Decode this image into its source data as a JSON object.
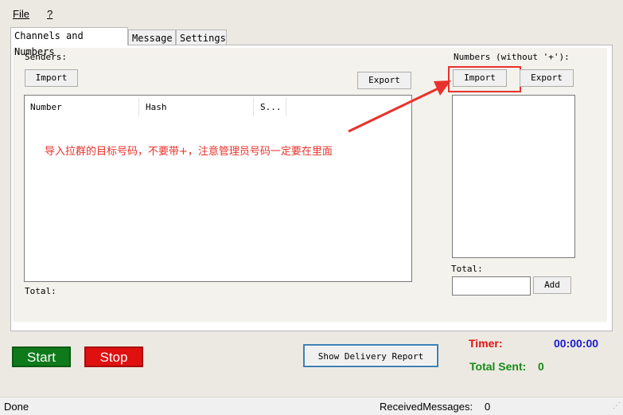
{
  "menu": {
    "file": "File",
    "help": "?"
  },
  "tabs": [
    "Channels and Numbers",
    "Message",
    "Settings"
  ],
  "senders": {
    "label": "Senders:",
    "import": "Import",
    "export": "Export",
    "columns": [
      "Number",
      "Hash",
      "S..."
    ],
    "total_label": "Total:"
  },
  "numbers": {
    "label": "Numbers (without '+'):",
    "import": "Import",
    "export": "Export",
    "total_label": "Total:",
    "add": "Add",
    "input_value": ""
  },
  "annotation": {
    "text": "导入拉群的目标号码，不要带+，注意管理员号码一定要在里面",
    "color": "#e8322b"
  },
  "controls": {
    "start": "Start",
    "stop": "Stop",
    "report": "Show Delivery Report"
  },
  "timer": {
    "label": "Timer:",
    "value": "00:00:00",
    "total_label": "Total Sent:",
    "total_value": "0"
  },
  "status": {
    "left": "Done",
    "received_label": "ReceivedMessages:",
    "received_value": "0"
  },
  "colors": {
    "start_bg": "#0f7a1c",
    "stop_bg": "#e01010",
    "red": "#e01010",
    "blue": "#1a1ad0",
    "green": "#178a17"
  }
}
